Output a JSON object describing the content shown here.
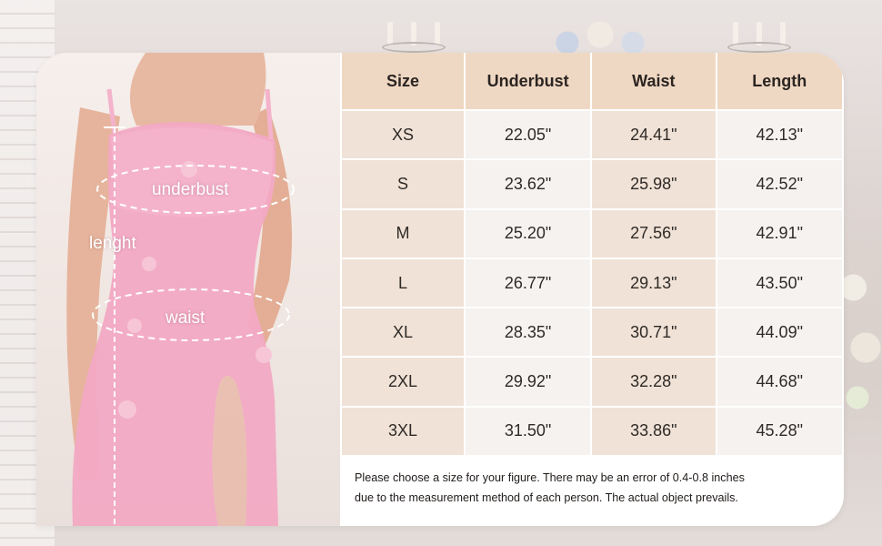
{
  "annotations": {
    "underbust": "underbust",
    "length": "lenght",
    "waist": "waist"
  },
  "table": {
    "headers": [
      "Size",
      "Underbust",
      "Waist",
      "Length"
    ],
    "rows": [
      [
        "XS",
        "22.05\"",
        "24.41\"",
        "42.13\""
      ],
      [
        "S",
        "23.62\"",
        "25.98\"",
        "42.52\""
      ],
      [
        "M",
        "25.20\"",
        "27.56\"",
        "42.91\""
      ],
      [
        "L",
        "26.77\"",
        "29.13\"",
        "43.50\""
      ],
      [
        "XL",
        "28.35\"",
        "30.71\"",
        "44.09\""
      ],
      [
        "2XL",
        "29.92\"",
        "32.28\"",
        "44.68\""
      ],
      [
        "3XL",
        "31.50\"",
        "33.86\"",
        "45.28\""
      ]
    ]
  },
  "note": {
    "line1": "Please choose a size for your figure. There may be an error of 0.4-0.8 inches",
    "line2": "due to the measurement method of each person. The actual object prevails."
  },
  "colors": {
    "header_bg": "#efd8c3",
    "cell_beige": "#f0e2d6",
    "cell_gray": "#f5f2f0",
    "dress_pink": "#f2a9c3"
  }
}
